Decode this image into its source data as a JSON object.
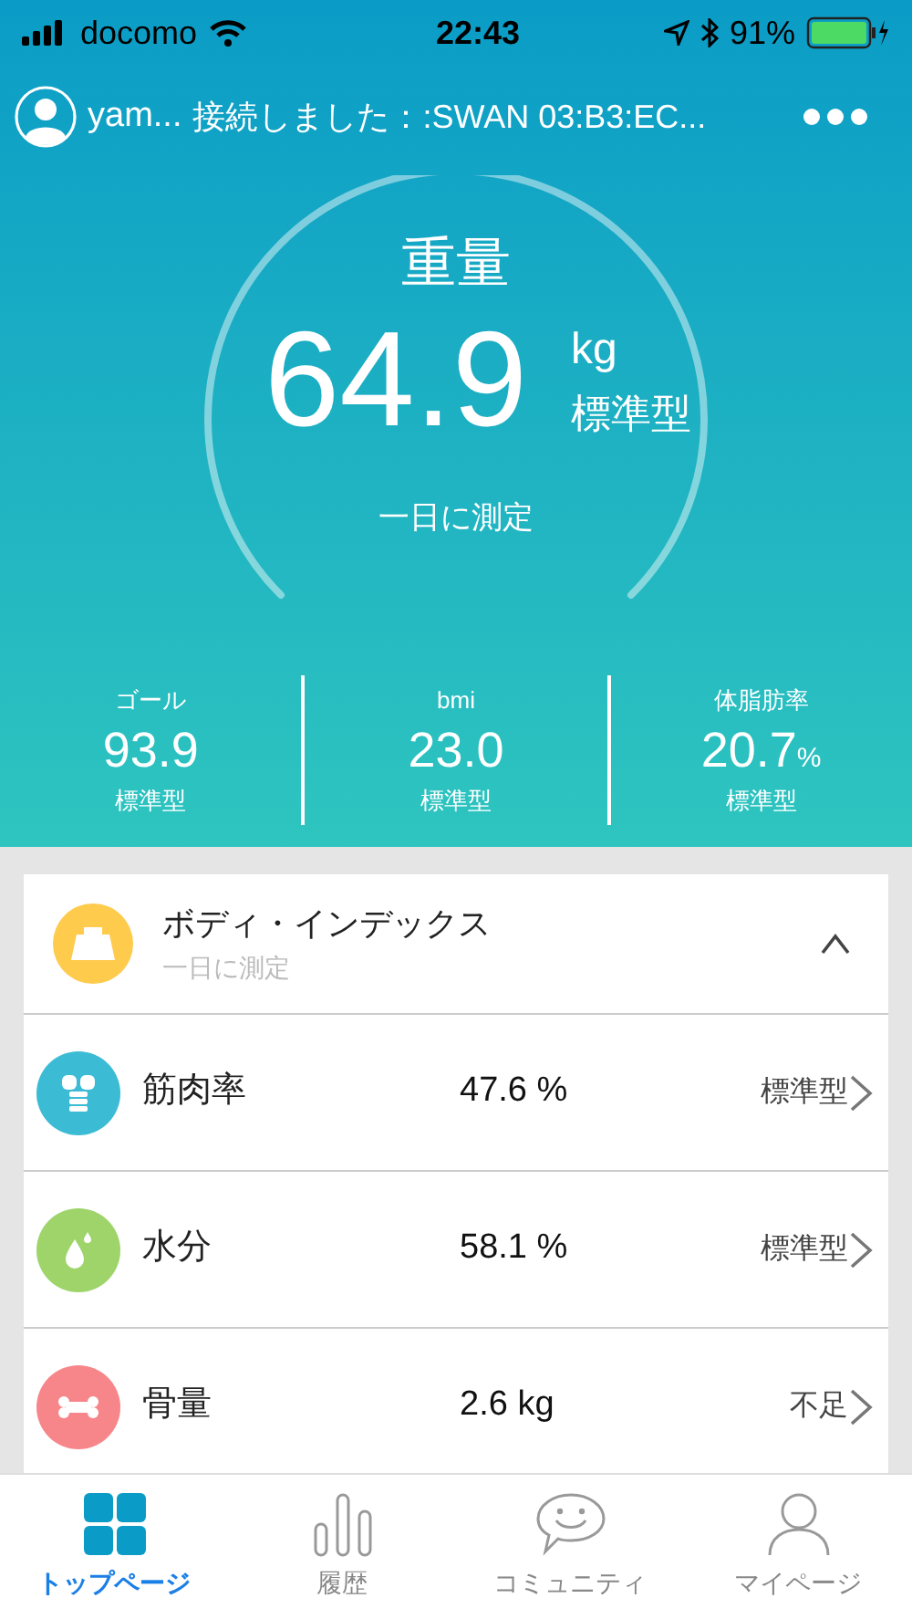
{
  "status_bar": {
    "carrier": "docomo",
    "time": "22:43",
    "battery": "91%"
  },
  "header": {
    "user": "yam...",
    "connection": "接続しました：:SWAN 03:B3:EC..."
  },
  "weight": {
    "title": "重量",
    "value": "64.9",
    "unit": "kg",
    "type": "標準型",
    "note": "一日に測定"
  },
  "stats": [
    {
      "label": "ゴール",
      "value": "93.9",
      "type": "標準型"
    },
    {
      "label": "bmi",
      "value": "23.0",
      "type": "標準型"
    },
    {
      "label": "体脂肪率",
      "value": "20.7",
      "unit": "%",
      "type": "標準型"
    }
  ],
  "section": {
    "title": "ボディ・インデックス",
    "subtitle": "一日に測定",
    "expanded": true
  },
  "rows": [
    {
      "kind": "muscle",
      "label": "筋肉率",
      "value": "47.6 %",
      "status": "標準型",
      "color": "#3bbcd4"
    },
    {
      "kind": "water",
      "label": "水分",
      "value": "58.1 %",
      "status": "標準型",
      "color": "#9ed46a"
    },
    {
      "kind": "bone",
      "label": "骨量",
      "value": "2.6 kg",
      "status": "不足",
      "color": "#f7868a"
    }
  ],
  "tabs": [
    {
      "label": "トップページ",
      "selected": true,
      "kind": "home"
    },
    {
      "label": "履歴",
      "selected": false,
      "kind": "history"
    },
    {
      "label": "コミュニティ",
      "selected": false,
      "kind": "community"
    },
    {
      "label": "マイページ",
      "selected": false,
      "kind": "mypage"
    }
  ]
}
